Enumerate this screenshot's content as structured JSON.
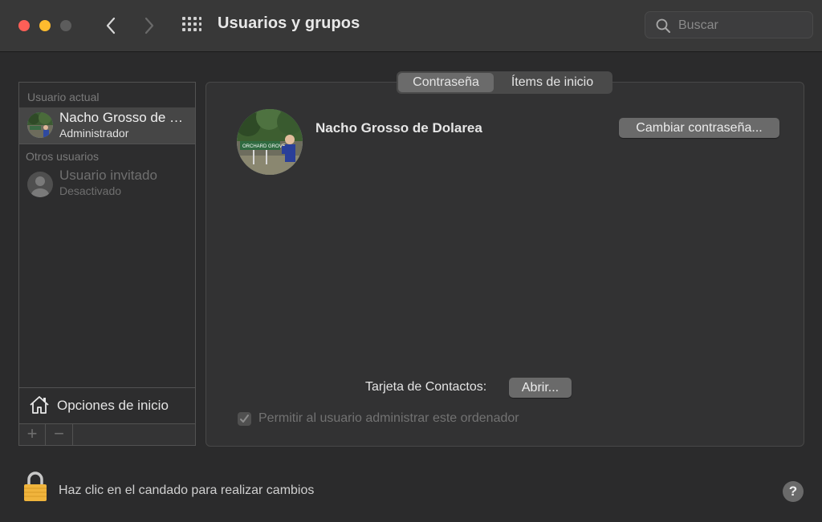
{
  "window": {
    "title": "Usuarios y grupos"
  },
  "search": {
    "placeholder": "Buscar"
  },
  "sidebar": {
    "current_user_label": "Usuario actual",
    "current_user": {
      "name": "Nacho Grosso de Dolarea",
      "role": "Administrador"
    },
    "other_users_label": "Otros usuarios",
    "guest_user": {
      "name": "Usuario invitado",
      "status": "Desactivado"
    },
    "login_options_label": "Opciones de inicio",
    "add_label": "+",
    "remove_label": "−"
  },
  "tabs": [
    {
      "label": "Contraseña",
      "active": true
    },
    {
      "label": "Ítems de inicio",
      "active": false
    }
  ],
  "main": {
    "user_name": "Nacho Grosso de Dolarea",
    "change_password_label": "Cambiar contraseña...",
    "contact_card_label": "Tarjeta de Contactos:",
    "open_label": "Abrir...",
    "allow_admin_label": "Permitir al usuario administrar este ordenador",
    "allow_admin_checked": true
  },
  "footer": {
    "lock_text": "Haz clic en el candado para realizar cambios",
    "help_label": "?"
  },
  "colors": {
    "close": "#ff5f57",
    "minimize": "#febc2e",
    "zoom_disabled": "#5c5c5c",
    "lock_gold": "#f0b43c"
  }
}
